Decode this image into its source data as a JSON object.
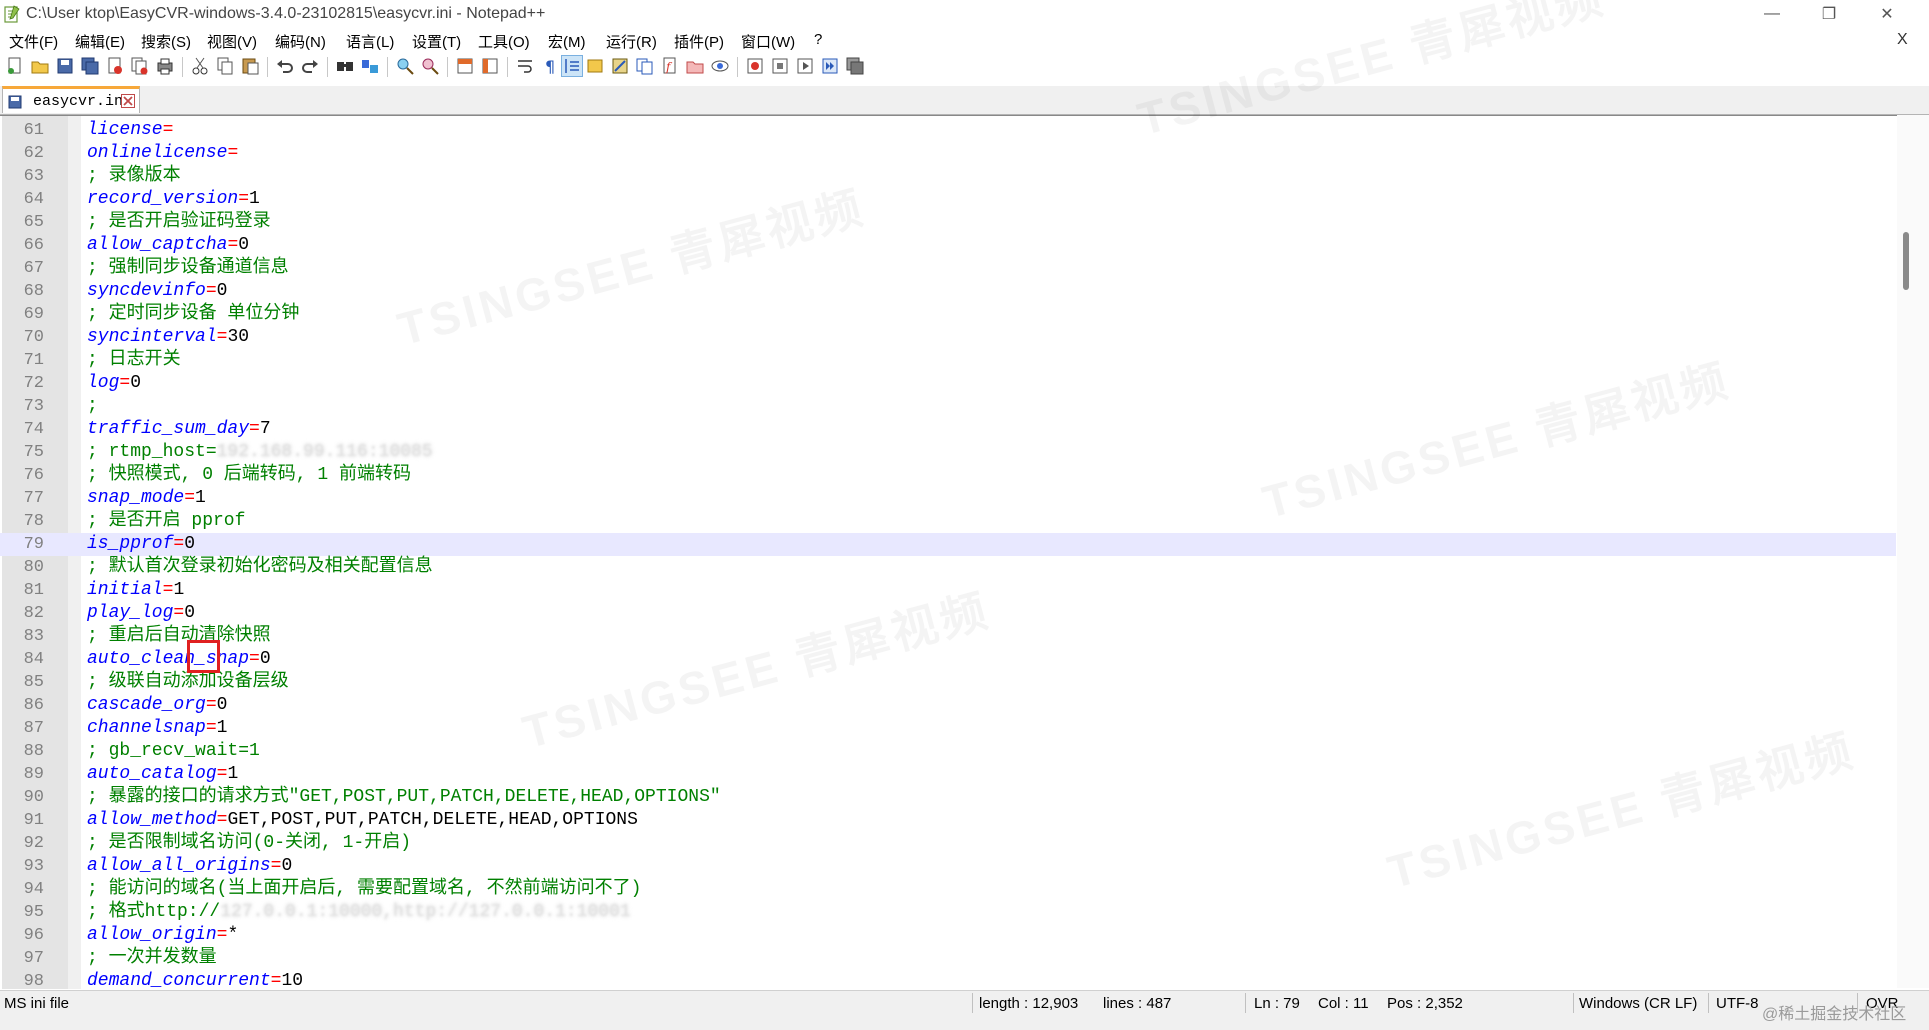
{
  "window": {
    "title": "C:\\User          ktop\\EasyCVR-windows-3.4.0-23102815\\easycvr.ini - Notepad++",
    "controls": {
      "minimize": "—",
      "maximize": "❐",
      "close": "✕"
    }
  },
  "menu": {
    "items": [
      "文件(F)",
      "编辑(E)",
      "搜索(S)",
      "视图(V)",
      "编码(N)",
      "语言(L)",
      "设置(T)",
      "工具(O)",
      "宏(M)",
      "运行(R)",
      "插件(P)",
      "窗口(W)",
      "?"
    ],
    "close": "X"
  },
  "toolbar": {
    "icons": [
      "new-file-icon",
      "open-file-icon",
      "save-icon",
      "save-all-icon",
      "close-icon",
      "close-all-icon",
      "print-icon",
      "cut-icon",
      "copy-icon",
      "paste-icon",
      "undo-icon",
      "redo-icon",
      "find-icon",
      "replace-icon",
      "zoom-in-icon",
      "zoom-out-icon",
      "sync-vertical-icon",
      "sync-horizontal-icon",
      "word-wrap-icon",
      "show-all-chars-icon",
      "indent-guide-icon",
      "udl-icon",
      "document-map-icon",
      "function-list-icon",
      "folder-workspace-icon",
      "monitoring-icon",
      "record-macro-icon",
      "stop-record-icon",
      "play-macro-icon",
      "run-macro-multiple-icon",
      "save-macro-icon"
    ]
  },
  "tab": {
    "label": "easycvr.ini"
  },
  "editor": {
    "current_line": 79,
    "lines": [
      {
        "n": "61",
        "type": "kv",
        "key": "license",
        "val": ""
      },
      {
        "n": "62",
        "type": "kv",
        "key": "onlinelicense",
        "val": ""
      },
      {
        "n": "63",
        "type": "comment",
        "text": "; 录像版本"
      },
      {
        "n": "64",
        "type": "kv",
        "key": "record_version",
        "val": "1"
      },
      {
        "n": "65",
        "type": "comment",
        "text": "; 是否开启验证码登录"
      },
      {
        "n": "66",
        "type": "kv",
        "key": "allow_captcha",
        "val": "0"
      },
      {
        "n": "67",
        "type": "comment",
        "text": "; 强制同步设备通道信息"
      },
      {
        "n": "68",
        "type": "kv",
        "key": "syncdevinfo",
        "val": "0"
      },
      {
        "n": "69",
        "type": "comment",
        "text": "; 定时同步设备 单位分钟"
      },
      {
        "n": "70",
        "type": "kv",
        "key": "syncinterval",
        "val": "30"
      },
      {
        "n": "71",
        "type": "comment",
        "text": "; 日志开关"
      },
      {
        "n": "72",
        "type": "kv",
        "key": "log",
        "val": "0"
      },
      {
        "n": "73",
        "type": "comment",
        "text": ";"
      },
      {
        "n": "74",
        "type": "kv",
        "key": "traffic_sum_day",
        "val": "7"
      },
      {
        "n": "75",
        "type": "comment",
        "text": "; rtmp_host=",
        "blurred": "192.168.99.116:10085"
      },
      {
        "n": "76",
        "type": "comment",
        "text": "; 快照模式, 0 后端转码, 1 前端转码"
      },
      {
        "n": "77",
        "type": "kv",
        "key": "snap_mode",
        "val": "1"
      },
      {
        "n": "78",
        "type": "comment",
        "text": "; 是否开启 pprof"
      },
      {
        "n": "79",
        "type": "kv",
        "key": "is_pprof",
        "val": "0"
      },
      {
        "n": "80",
        "type": "comment",
        "text": "; 默认首次登录初始化密码及相关配置信息"
      },
      {
        "n": "81",
        "type": "kv",
        "key": "initial",
        "val": "1"
      },
      {
        "n": "82",
        "type": "kv",
        "key": "play_log",
        "val": "0"
      },
      {
        "n": "83",
        "type": "comment",
        "text": "; 重启后自动清除快照"
      },
      {
        "n": "84",
        "type": "kv",
        "key": "auto_clean_snap",
        "val": "0"
      },
      {
        "n": "85",
        "type": "comment",
        "text": "; 级联自动添加设备层级"
      },
      {
        "n": "86",
        "type": "kv",
        "key": "cascade_org",
        "val": "0"
      },
      {
        "n": "87",
        "type": "kv",
        "key": "channelsnap",
        "val": "1"
      },
      {
        "n": "88",
        "type": "comment",
        "text": "; gb_recv_wait=1"
      },
      {
        "n": "89",
        "type": "kv",
        "key": "auto_catalog",
        "val": "1"
      },
      {
        "n": "90",
        "type": "comment",
        "text": "; 暴露的接口的请求方式\"GET,POST,PUT,PATCH,DELETE,HEAD,OPTIONS\""
      },
      {
        "n": "91",
        "type": "kv",
        "key": "allow_method",
        "val": "GET,POST,PUT,PATCH,DELETE,HEAD,OPTIONS"
      },
      {
        "n": "92",
        "type": "comment",
        "text": "; 是否限制域名访问(0-关闭, 1-开启)"
      },
      {
        "n": "93",
        "type": "kv",
        "key": "allow_all_origins",
        "val": "0"
      },
      {
        "n": "94",
        "type": "comment",
        "text": "; 能访问的域名(当上面开启后, 需要配置域名, 不然前端访问不了)"
      },
      {
        "n": "95",
        "type": "comment",
        "text": "; 格式http://",
        "blurred": "127.0.0.1:10000,http://127.0.0.1:10001"
      },
      {
        "n": "96",
        "type": "kv",
        "key": "allow_origin",
        "val": "*"
      },
      {
        "n": "97",
        "type": "comment",
        "text": "; 一次并发数量"
      },
      {
        "n": "98",
        "type": "kv",
        "key": "demand_concurrent",
        "val": "10"
      }
    ]
  },
  "status": {
    "file_type": "MS ini file",
    "length": "length : 12,903",
    "lines": "lines : 487",
    "ln": "Ln : 79",
    "col": "Col : 11",
    "pos": "Pos : 2,352",
    "eol": "Windows (CR LF)",
    "encoding": "UTF-8",
    "mode": "OVR"
  },
  "watermark": {
    "text": "TSINGSEE 青犀视频"
  },
  "attribution": "@稀土掘金技术社区"
}
